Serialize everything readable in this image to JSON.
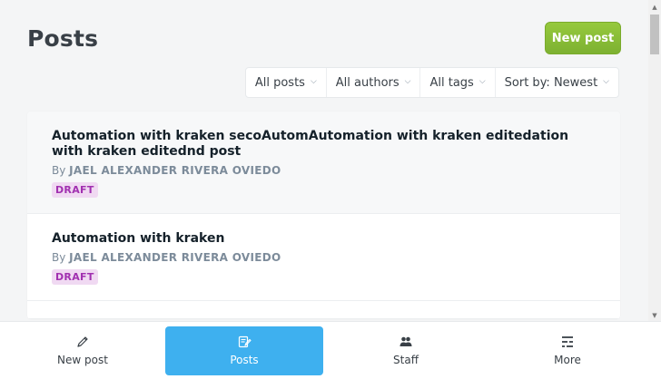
{
  "header": {
    "title": "Posts",
    "new_post_label": "New post"
  },
  "filters": [
    {
      "label": "All posts"
    },
    {
      "label": "All authors"
    },
    {
      "label": "All tags"
    },
    {
      "label": "Sort by: Newest"
    }
  ],
  "posts": [
    {
      "title": "Automation with kraken secoAutomAutomation with kraken editedation with kraken editednd post",
      "by": "By",
      "author": "JAEL ALEXANDER RIVERA OVIEDO",
      "status": "DRAFT"
    },
    {
      "title": "Automation with kraken",
      "by": "By",
      "author": "JAEL ALEXANDER RIVERA OVIEDO",
      "status": "DRAFT"
    }
  ],
  "tabbar": {
    "items": [
      {
        "label": "New post",
        "icon": "pencil-icon"
      },
      {
        "label": "Posts",
        "icon": "posts-icon",
        "active": true
      },
      {
        "label": "Staff",
        "icon": "staff-icon"
      },
      {
        "label": "More",
        "icon": "more-icon"
      }
    ]
  },
  "colors": {
    "accent_green": "#7db131",
    "active_tab": "#3eb0ef",
    "draft_badge_bg": "#f0d9f2",
    "draft_badge_text": "#a130b0"
  }
}
